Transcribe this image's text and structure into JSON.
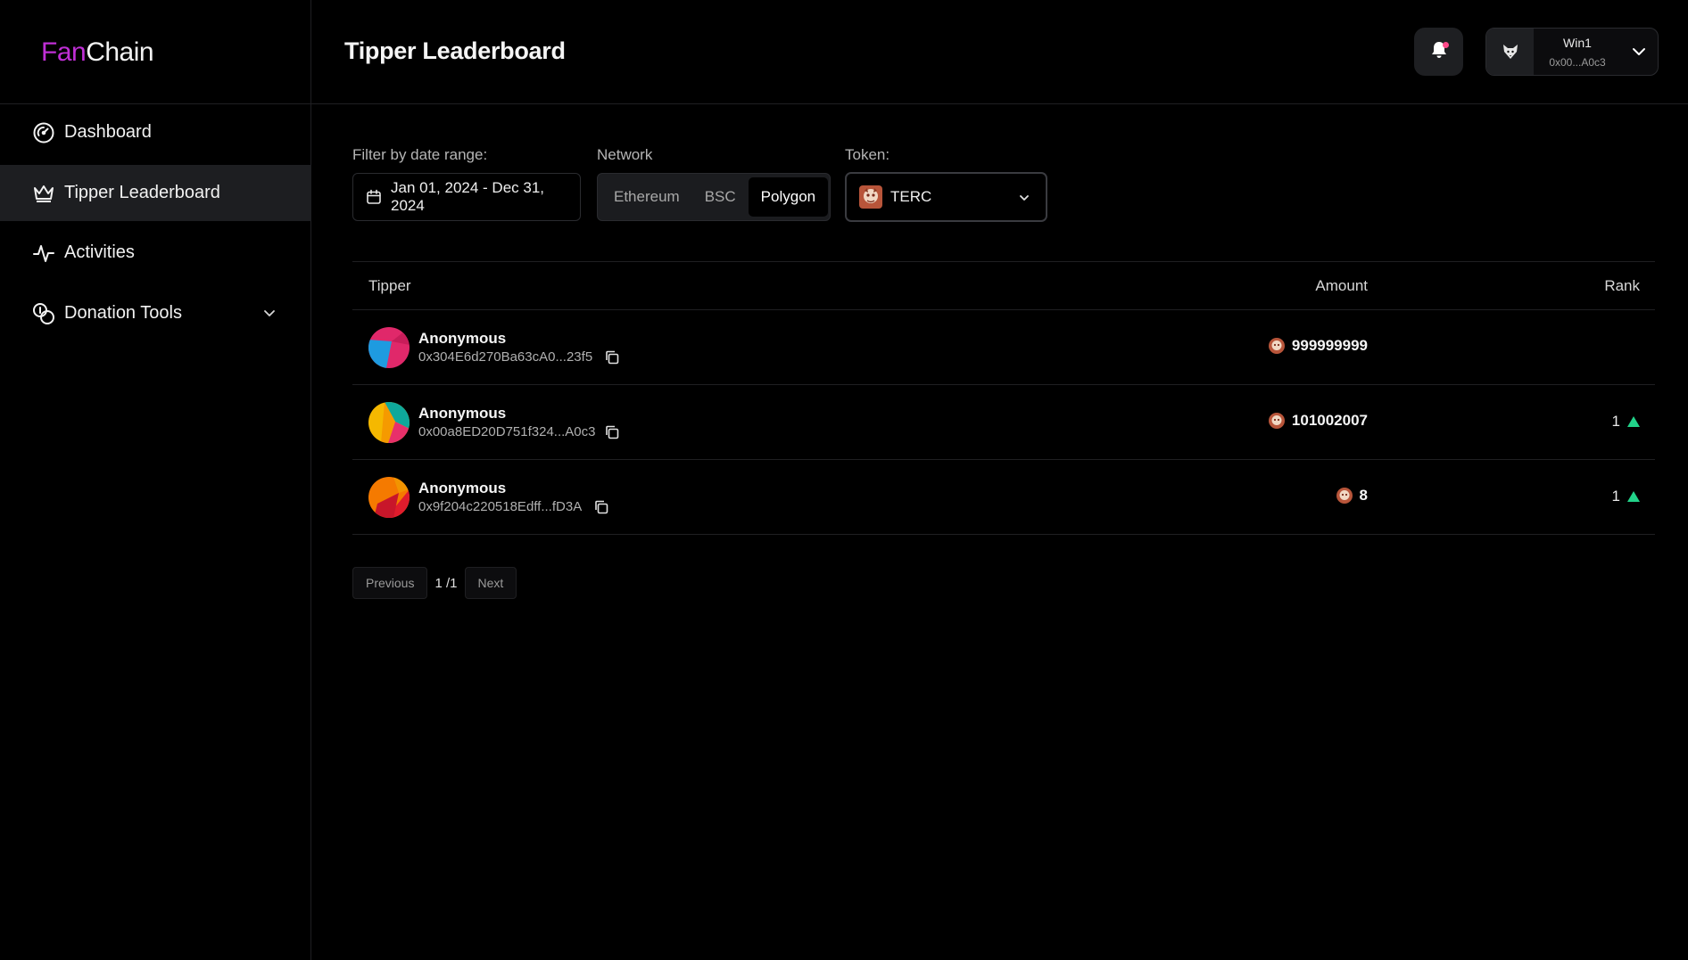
{
  "app": {
    "logo_part1": "Fan",
    "logo_part2": "Chain"
  },
  "sidebar": {
    "items": [
      {
        "label": "Dashboard",
        "icon": "gauge-icon",
        "active": false
      },
      {
        "label": "Tipper Leaderboard",
        "icon": "crown-icon",
        "active": true
      },
      {
        "label": "Activities",
        "icon": "activity-icon",
        "active": false
      },
      {
        "label": "Donation Tools",
        "icon": "coins-icon",
        "active": false,
        "has_dropdown": true
      }
    ]
  },
  "header": {
    "title": "Tipper Leaderboard",
    "notification_icon": "bell-icon",
    "user": {
      "name": "Win1",
      "address": "0x00...A0c3"
    }
  },
  "filters": {
    "date_label": "Filter by date range:",
    "date_value": "Jan 01, 2024 - Dec 31, 2024",
    "network_label": "Network",
    "networks": [
      "Ethereum",
      "BSC",
      "Polygon"
    ],
    "network_selected": "Polygon",
    "token_label": "Token:",
    "token_value": "TERC"
  },
  "table": {
    "headers": {
      "tipper": "Tipper",
      "amount": "Amount",
      "rank": "Rank"
    },
    "rows": [
      {
        "name": "Anonymous",
        "address": "0x304E6d270Ba63cA0...23f5",
        "amount": "999999999",
        "rank": "",
        "trend": "none"
      },
      {
        "name": "Anonymous",
        "address": "0x00a8ED20D751f324...A0c3",
        "amount": "101002007",
        "rank": "1",
        "trend": "up"
      },
      {
        "name": "Anonymous",
        "address": "0x9f204c220518Edff...fD3A",
        "amount": "8",
        "rank": "1",
        "trend": "up"
      }
    ]
  },
  "pagination": {
    "prev_label": "Previous",
    "current": "1",
    "total": "/1",
    "next_label": "Next"
  },
  "colors": {
    "brand": "#c02fd6",
    "background": "#000000",
    "rank_up": "#22d38a"
  }
}
